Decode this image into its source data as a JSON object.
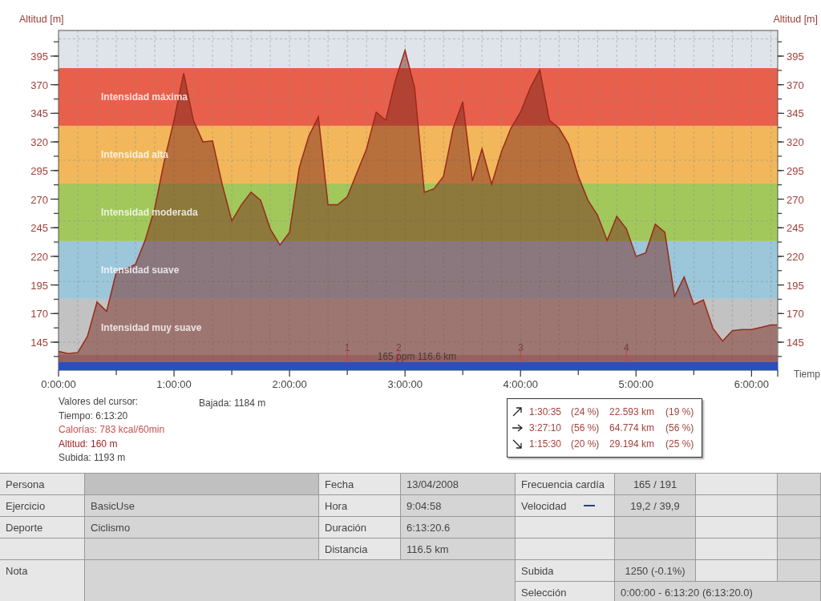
{
  "chart": {
    "right_axis_title": "Altitud [m]",
    "left_axis_ticks": [
      "395",
      "370",
      "345",
      "320",
      "295",
      "270",
      "245",
      "220",
      "195",
      "170",
      "145"
    ],
    "right_axis_ticks": [
      "395",
      "370",
      "345",
      "320",
      "295",
      "270",
      "245",
      "220",
      "195",
      "170",
      "145"
    ],
    "track_label": "165 ppm 116.6 km",
    "chart_data": {
      "type": "area",
      "ylabel": "Altitud [m]",
      "xlabel": "Tiemp",
      "xlim": [
        0,
        373.6
      ],
      "ylim": [
        120.5,
        417.4
      ],
      "grid": true,
      "bands": [
        {
          "axis": "y",
          "from": 334.1,
          "to": 384.5,
          "label": "Intensidad máxima",
          "color": "#e8604c"
        },
        {
          "axis": "y",
          "from": 283.7,
          "to": 334.1,
          "label": "Intensidad alta",
          "color": "#f2b75a"
        },
        {
          "axis": "y",
          "from": 233.3,
          "to": 283.7,
          "label": "Intensidad moderada",
          "color": "#a2c85c"
        },
        {
          "axis": "y",
          "from": 182.9,
          "to": 233.3,
          "label": "Intensidad suave",
          "color": "#9cc6da"
        },
        {
          "axis": "y",
          "from": 132.5,
          "to": 182.9,
          "label": "Intensidad muy suave",
          "color": "#c2c2c2"
        }
      ],
      "x": [
        0,
        5,
        10,
        15,
        20,
        25,
        30,
        35,
        40,
        45,
        50,
        55,
        60,
        65,
        70,
        75,
        80,
        85,
        90,
        95,
        100,
        105,
        110,
        115,
        120,
        125,
        130,
        135,
        140,
        145,
        150,
        155,
        160,
        165,
        170,
        175,
        180,
        185,
        190,
        195,
        200,
        205,
        210,
        215,
        220,
        225,
        230,
        235,
        240,
        245,
        250,
        255,
        260,
        265,
        270,
        275,
        280,
        285,
        290,
        295,
        300,
        305,
        310,
        315,
        320,
        325,
        330,
        335,
        340,
        345,
        350,
        355,
        360,
        365,
        370,
        373.3
      ],
      "series": [
        {
          "color": "#9b2a1a",
          "values": [
            137,
            135,
            136,
            150,
            180,
            172,
            206,
            209,
            213,
            234,
            262,
            304,
            339,
            380,
            339,
            320,
            321,
            283,
            251,
            265,
            276,
            269,
            244,
            230,
            241,
            297,
            325,
            342,
            265,
            265,
            272,
            293,
            314,
            346,
            339,
            374,
            400,
            367,
            276,
            279,
            290,
            332,
            355,
            286,
            314,
            283,
            311,
            332,
            346,
            367,
            383,
            339,
            332,
            318,
            290,
            269,
            256,
            234,
            255,
            244,
            220,
            223,
            248,
            241,
            185,
            202,
            178,
            182,
            157,
            146,
            155,
            156,
            156,
            158,
            160,
            160
          ]
        }
      ],
      "xticks": [
        {
          "value": 0,
          "label": "0:00:00"
        },
        {
          "value": 60,
          "label": "1:00:00"
        },
        {
          "value": 120,
          "label": "2:00:00"
        },
        {
          "value": 180,
          "label": "3:00:00"
        },
        {
          "value": 240,
          "label": "4:00:00"
        },
        {
          "value": 300,
          "label": "5:00:00"
        },
        {
          "value": 360,
          "label": "6:00:00"
        }
      ],
      "yticks": [
        145,
        170,
        195,
        220,
        245,
        270,
        295,
        320,
        345,
        370,
        395
      ],
      "annotations": [
        {
          "x": 150,
          "y": 135,
          "text": "1"
        },
        {
          "x": 176.7,
          "y": 135,
          "text": "2"
        },
        {
          "x": 240,
          "y": 135,
          "text": "3"
        },
        {
          "x": 295,
          "y": 135,
          "text": "4"
        }
      ]
    }
  },
  "cursor": {
    "title": "Valores del cursor:",
    "lines": [
      {
        "text": "Tiempo: 6:13:20",
        "color": "#444444"
      },
      {
        "text": "Calorías: 783 kcal/60min",
        "color": "#c65050"
      },
      {
        "text": "Altitud: 160 m",
        "color": "#a02424"
      },
      {
        "text": "Subida: 1193 m",
        "color": "#444444"
      }
    ],
    "descent": "Bajada: 1184 m"
  },
  "summary": [
    {
      "kind": "up",
      "time": "1:30:35",
      "time_share": "(24 %)",
      "distance": "22.593 km",
      "distance_share": "(19 %)"
    },
    {
      "kind": "flat",
      "time": "3:27:10",
      "time_share": "(56 %)",
      "distance": "64.774 km",
      "distance_share": "(56 %)"
    },
    {
      "kind": "down",
      "time": "1:15:30",
      "time_share": "(20 %)",
      "distance": "29.194 km",
      "distance_share": "(25 %)"
    }
  ],
  "person_fields": [
    {
      "label": "Persona"
    },
    {
      "label": "Ejercicio",
      "value": "BasicUse"
    },
    {
      "label": "Deporte",
      "value": "Ciclismo"
    }
  ],
  "note": {
    "label": "Nota"
  },
  "session_fields": [
    {
      "label": "Fecha",
      "value": "13/04/2008"
    },
    {
      "label": "Hora",
      "value": "9:04:58"
    },
    {
      "label": "Duración",
      "value": "6:13:20.6"
    },
    {
      "label": "Distancia",
      "value": "116.5 km"
    }
  ],
  "measure_fields": [
    {
      "label": "Frecuencia cardía",
      "value": "165 / 191"
    },
    {
      "label": "Velocidad",
      "value": "19,2 / 39,9",
      "color": "#2a3f8f"
    }
  ],
  "ascent": {
    "label": "Subida",
    "value": "1250 (-0.1%)"
  },
  "selection": {
    "label": "Selección",
    "value": "0:00:00 - 6:13:20 (6:13:20.0)"
  }
}
